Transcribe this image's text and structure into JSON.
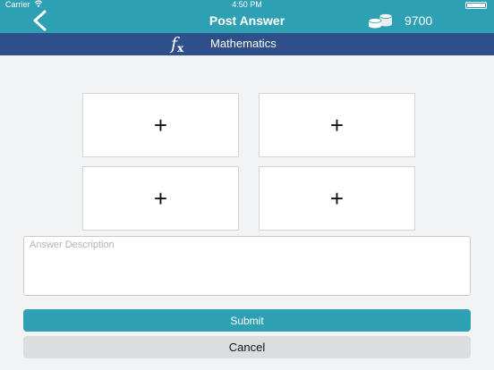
{
  "status_bar": {
    "carrier": "Carrier",
    "time": "4:50 PM",
    "wifi_icon": "wifi-icon",
    "battery_icon": "battery-icon"
  },
  "header": {
    "back_icon": "chevron-left-icon",
    "title": "Post Answer",
    "coins_icon": "coins-icon",
    "coins": "9700",
    "background_color": "#2ea0b4"
  },
  "subject": {
    "icon": "fx-icon",
    "icon_text": "f",
    "icon_sub": "x",
    "label": "Mathematics",
    "background_color": "#2e4f8a"
  },
  "upload_slots": [
    {
      "icon": "plus-icon",
      "symbol": "+"
    },
    {
      "icon": "plus-icon",
      "symbol": "+"
    },
    {
      "icon": "plus-icon",
      "symbol": "+"
    },
    {
      "icon": "plus-icon",
      "symbol": "+"
    }
  ],
  "answer": {
    "placeholder": "Answer Description",
    "value": ""
  },
  "actions": {
    "submit_label": "Submit",
    "cancel_label": "Cancel"
  }
}
